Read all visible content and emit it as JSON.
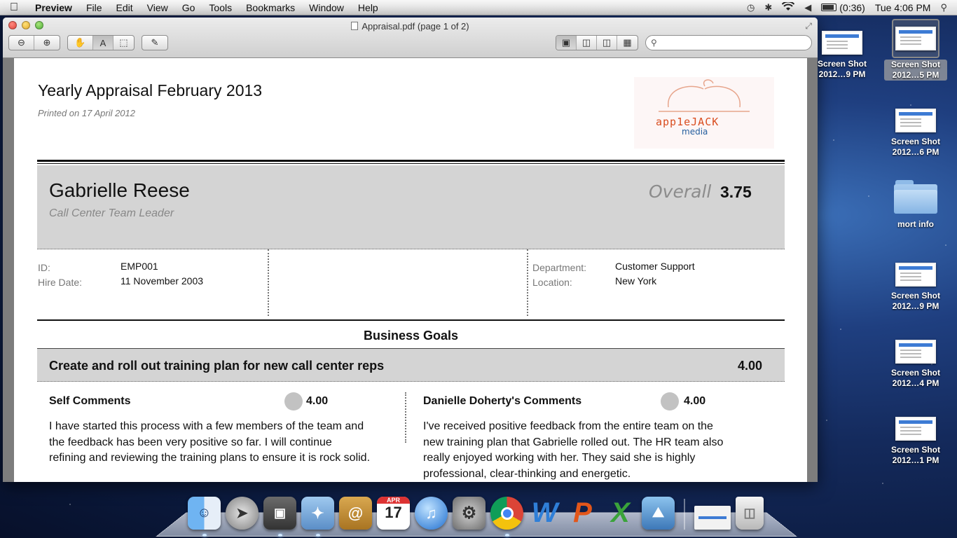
{
  "menubar": {
    "app": "Preview",
    "items": [
      "File",
      "Edit",
      "View",
      "Go",
      "Tools",
      "Bookmarks",
      "Window",
      "Help"
    ],
    "battery": "(0:36)",
    "clock": "Tue 4:06 PM"
  },
  "window": {
    "title": "Appraisal.pdf (page 1 of 2)",
    "search_placeholder": ""
  },
  "document": {
    "title": "Yearly Appraisal February 2013",
    "printed": "Printed on 17 April 2012",
    "logo_line1": "app1eJACK",
    "logo_line2": "media",
    "employee": {
      "name": "Gabrielle Reese",
      "role": "Call Center Team Leader",
      "overall_label": "Overall",
      "overall_value": "3.75"
    },
    "info": {
      "id_label": "ID:",
      "id_value": "EMP001",
      "hire_label": "Hire Date:",
      "hire_value": "11 November 2003",
      "dept_label": "Department:",
      "dept_value": "Customer Support",
      "loc_label": "Location:",
      "loc_value": "New York"
    },
    "section_title": "Business Goals",
    "goal": {
      "text": "Create and roll out training plan for new call center reps",
      "score": "4.00",
      "self_heading": "Self Comments",
      "self_score": "4.00",
      "self_body": "I have started this process with a few members of the team and the feedback has been very positive so far.  I will continue refining and reviewing the training plans to ensure it is rock solid.",
      "manager_heading": "Danielle Doherty's Comments",
      "manager_score": "4.00",
      "manager_body": "I've received positive feedback from the entire team on the new training plan that Gabrielle rolled out.  The HR team also really enjoyed working with her.  They said she is highly professional, clear-thinking and energetic."
    }
  },
  "desktop": {
    "icons": [
      {
        "line1": "Screen Shot",
        "line2": "2012…9 PM"
      },
      {
        "line1": "Screen Shot",
        "line2": "2012…5 PM"
      },
      {
        "line1": "Screen Shot",
        "line2": "2012…6 PM"
      },
      {
        "line1": "mort info"
      },
      {
        "line1": "Screen Shot",
        "line2": "2012…9 PM"
      },
      {
        "line1": "Screen Shot",
        "line2": "2012…4 PM"
      },
      {
        "line1": "Screen Shot",
        "line2": "2012…1 PM"
      }
    ]
  },
  "dock": {
    "apps": [
      "finder-icon",
      "launchpad-icon",
      "photo-booth-icon",
      "preview-icon",
      "address-book-icon",
      "ical-icon",
      "itunes-icon",
      "system-preferences-icon",
      "chrome-icon",
      "word-icon",
      "powerpoint-icon",
      "excel-icon",
      "iphoto-icon",
      "documents-stack-icon",
      "trash-icon"
    ],
    "ical_month": "APR",
    "ical_day": "17",
    "word_letter": "W",
    "powerpoint_letter": "P",
    "excel_letter": "X",
    "colors": {
      "accent": "#3d7bd4",
      "word": "#2f7fd8",
      "powerpoint": "#e2561a",
      "excel": "#3aa33a"
    }
  }
}
